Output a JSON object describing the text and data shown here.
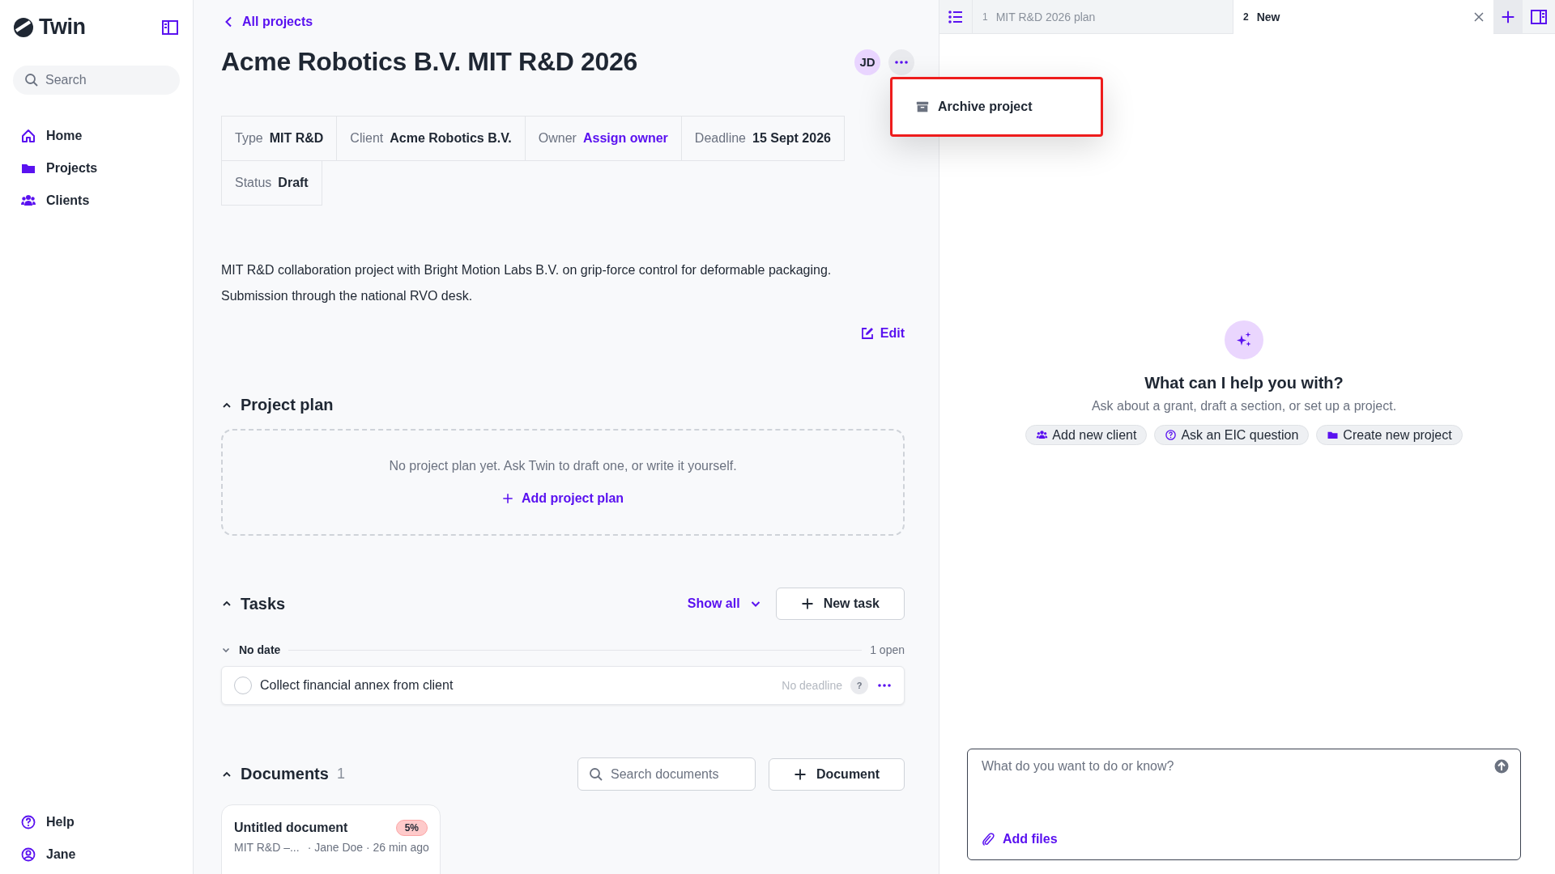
{
  "sidebar": {
    "logo": "Twin",
    "search": {
      "placeholder": "Search"
    },
    "nav": [
      {
        "label": "Home",
        "kind": "home"
      },
      {
        "label": "Projects",
        "kind": "folder"
      },
      {
        "label": "Clients",
        "kind": "people"
      }
    ],
    "footer": [
      {
        "label": "Help",
        "kind": "help"
      },
      {
        "label": "Jane",
        "kind": "user"
      }
    ]
  },
  "main": {
    "back_link": "All projects",
    "title": "Acme Robotics B.V. MIT R&D 2026",
    "avatar": "JD",
    "meta": [
      {
        "label": "Type",
        "value": "MIT R&D",
        "kind": "text"
      },
      {
        "label": "Client",
        "value": "Acme Robotics B.V.",
        "kind": "text"
      },
      {
        "label": "Owner",
        "value": "Assign owner",
        "kind": "link"
      },
      {
        "label": "Deadline",
        "value": "15 Sept 2026",
        "kind": "text"
      },
      {
        "label": "Status",
        "value": "Draft",
        "kind": "text"
      }
    ],
    "description": [
      "MIT R&D collaboration project with Bright Motion Labs B.V. on grip-force control for deformable packaging.",
      "Submission through the national RVO desk."
    ],
    "edit": "Edit",
    "project_plan": {
      "title": "Project plan",
      "expanded": true,
      "empty_text": "No project plan yet. Ask Twin to draft one, or write it yourself.",
      "add": "Add project plan"
    },
    "tasks": {
      "title": "Tasks",
      "expanded": true,
      "filter": "Show all",
      "new_button": "New task",
      "groups": [
        {
          "title": "No date",
          "count": "1 open",
          "expanded": true,
          "tasks": [
            {
              "title": "Collect financial annex from client",
              "done": false,
              "deadline": "No deadline",
              "badge": "?"
            }
          ]
        }
      ]
    },
    "documents": {
      "title": "Documents",
      "count": "1",
      "expanded": true,
      "search": {
        "placeholder": "Search documents"
      },
      "add": "Document",
      "items": [
        {
          "title": "Untitled document",
          "progress": "5%",
          "type": "MIT R&D –...",
          "meta": "· Jane Doe · 26 min ago"
        }
      ]
    }
  },
  "menu": {
    "items": [
      {
        "label": "Archive project",
        "kind": "archive"
      }
    ]
  },
  "assistant": {
    "tabs": [
      {
        "number": "1",
        "label": "MIT R&D 2026 plan",
        "selected": false
      },
      {
        "number": "2",
        "label": "New",
        "selected": true
      }
    ],
    "heading": "What can I help you with?",
    "subtitle": "Ask about a grant, draft a section, or set up a project.",
    "chips": [
      {
        "label": "Add new client",
        "kind": "people"
      },
      {
        "label": "Ask an EIC question",
        "kind": "help"
      },
      {
        "label": "Create new project",
        "kind": "folder"
      }
    ],
    "input": {
      "placeholder": "What do you want to do or know?"
    },
    "add_files": "Add files"
  }
}
